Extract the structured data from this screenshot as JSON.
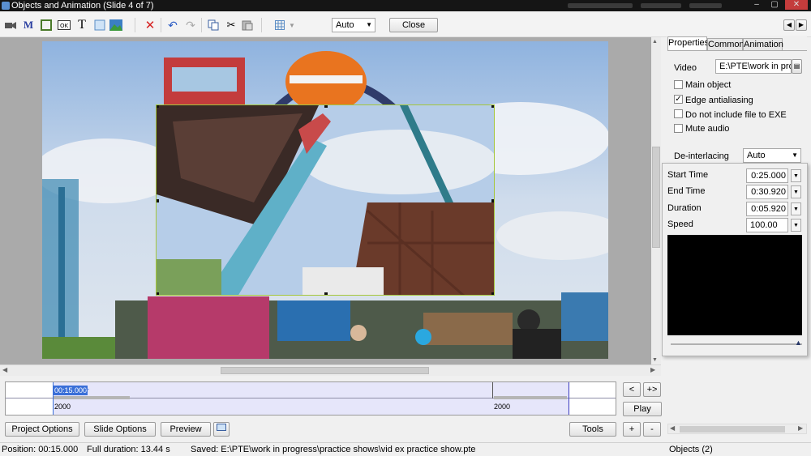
{
  "window": {
    "title": "Objects and Animation  (Slide 4 of 7)"
  },
  "toolbar": {
    "icons": [
      "camera-icon",
      "text-m-icon",
      "frame-icon",
      "ok-button-icon",
      "text-t-icon",
      "rectangle-icon",
      "image-icon",
      "delete-icon",
      "undo-icon",
      "redo-icon",
      "copy-icon",
      "cut-icon",
      "paste-icon",
      "grid-icon"
    ],
    "zoom_value": "Auto",
    "close_label": "Close"
  },
  "timeline": {
    "position_label": "00:15.000",
    "marker_left": "2000",
    "marker_right": "2000"
  },
  "nav": {
    "prev": "<",
    "next": "+>",
    "play": "Play"
  },
  "bottom_buttons": {
    "project_options": "Project Options",
    "slide_options": "Slide Options",
    "preview": "Preview",
    "tools": "Tools",
    "plus": "+",
    "minus": "-"
  },
  "properties": {
    "tabs": [
      "Properties",
      "Common",
      "Animation"
    ],
    "video_label": "Video",
    "video_path": "E:\\PTE\\work in progre",
    "checkboxes": [
      {
        "label": "Main object",
        "checked": false
      },
      {
        "label": "Edge antialiasing",
        "checked": true
      },
      {
        "label": "Do not include file to EXE",
        "checked": false
      },
      {
        "label": "Mute audio",
        "checked": false
      }
    ],
    "deinterlacing_label": "De-interlacing",
    "deinterlacing_value": "Auto",
    "start_time_label": "Start Time",
    "start_time": "0:25.000",
    "end_time_label": "End Time",
    "end_time": "0:30.920",
    "duration_label": "Duration",
    "duration": "0:05.920",
    "speed_label": "Speed",
    "speed": "100.00"
  },
  "status": {
    "position": "Position:  00:15.000",
    "full_duration": "Full duration:  13.44 s",
    "saved": "Saved: E:\\PTE\\work in progress\\practice shows\\vid ex practice show.pte",
    "objects": "Objects (2)"
  },
  "colors": {
    "accent": "#3a6fd8",
    "selection": "#a5c63b",
    "timeline_fill": "#e6e6fa"
  }
}
